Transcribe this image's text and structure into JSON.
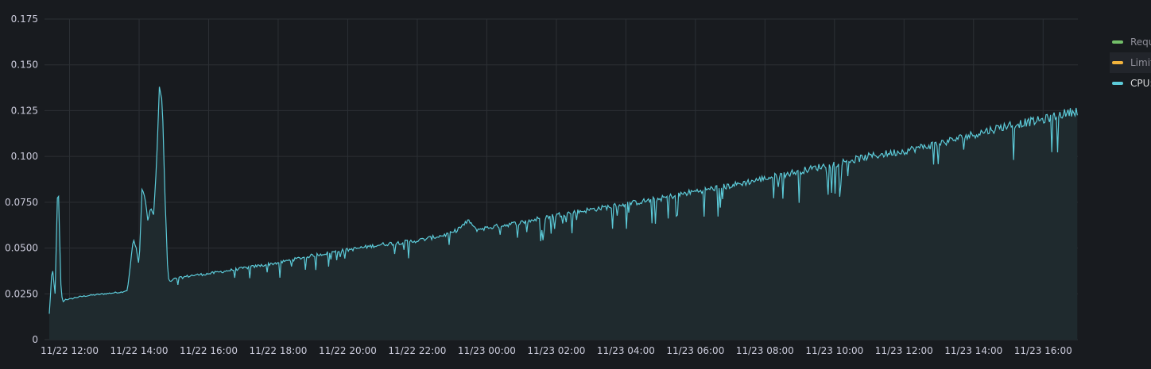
{
  "colors": {
    "background": "#181b1f",
    "grid": "#2c3035",
    "series_cpu": "#5ccad8",
    "series_cpu_fill": "#1f2a2e",
    "series_requests": "#73bf69",
    "series_limits": "#f2b33c",
    "tick_text": "#ccccdc"
  },
  "legend": {
    "placement": "right",
    "items": [
      {
        "label": "Requ",
        "color": "#73bf69"
      },
      {
        "label": "Limit",
        "color": "#f2b33c"
      },
      {
        "label": "CPU:",
        "color": "#5ccad8"
      }
    ]
  },
  "chart_data": {
    "type": "area",
    "title": "",
    "xlabel": "",
    "ylabel": "",
    "ylim": [
      0,
      0.175
    ],
    "xlim": [
      "11/22 11:25",
      "11/23 17:00"
    ],
    "grid": true,
    "yticks": [
      "0",
      "0.0250",
      "0.0500",
      "0.0750",
      "0.100",
      "0.125",
      "0.150",
      "0.175"
    ],
    "ytick_values": [
      0,
      0.025,
      0.05,
      0.075,
      0.1,
      0.125,
      0.15,
      0.175
    ],
    "xticks": [
      "11/22 12:00",
      "11/22 14:00",
      "11/22 16:00",
      "11/22 18:00",
      "11/22 20:00",
      "11/22 22:00",
      "11/23 00:00",
      "11/23 02:00",
      "11/23 04:00",
      "11/23 06:00",
      "11/23 08:00",
      "11/23 10:00",
      "11/23 12:00",
      "11/23 14:00",
      "11/23 16:00"
    ],
    "series": [
      {
        "name": "CPU:",
        "x": [
          "11/22 11:25",
          "11/22 11:30",
          "11/22 11:35",
          "11/22 11:40",
          "11/22 11:45",
          "11/22 11:48",
          "11/22 11:52",
          "11/22 11:56",
          "11/22 12:00",
          "11/22 12:10",
          "11/22 12:30",
          "11/22 13:00",
          "11/22 13:30",
          "11/22 13:40",
          "11/22 13:50",
          "11/22 13:55",
          "11/22 14:00",
          "11/22 14:05",
          "11/22 14:10",
          "11/22 14:15",
          "11/22 14:20",
          "11/22 14:25",
          "11/22 14:30",
          "11/22 14:35",
          "11/22 14:40",
          "11/22 14:45",
          "11/22 14:50",
          "11/22 14:55",
          "11/22 15:00",
          "11/22 15:30",
          "11/22 16:00",
          "11/22 17:00",
          "11/22 18:00",
          "11/22 19:00",
          "11/22 20:00",
          "11/22 21:00",
          "11/22 22:00",
          "11/22 23:00",
          "11/22 23:30",
          "11/22 23:40",
          "11/23 00:00",
          "11/23 01:00",
          "11/23 02:00",
          "11/23 03:00",
          "11/23 04:00",
          "11/23 05:00",
          "11/23 06:00",
          "11/23 07:00",
          "11/23 08:00",
          "11/23 09:00",
          "11/23 10:00",
          "11/23 11:00",
          "11/23 12:00",
          "11/23 13:00",
          "11/23 14:00",
          "11/23 15:00",
          "11/23 16:00",
          "11/23 16:30",
          "11/23 17:00"
        ],
        "values": [
          0.014,
          0.04,
          0.025,
          0.09,
          0.03,
          0.02,
          0.022,
          0.022,
          0.022,
          0.023,
          0.024,
          0.025,
          0.026,
          0.027,
          0.055,
          0.05,
          0.04,
          0.082,
          0.078,
          0.065,
          0.072,
          0.068,
          0.095,
          0.138,
          0.13,
          0.075,
          0.033,
          0.032,
          0.033,
          0.035,
          0.036,
          0.039,
          0.042,
          0.046,
          0.049,
          0.052,
          0.054,
          0.058,
          0.065,
          0.06,
          0.061,
          0.064,
          0.068,
          0.071,
          0.074,
          0.077,
          0.081,
          0.084,
          0.088,
          0.092,
          0.096,
          0.1,
          0.103,
          0.107,
          0.112,
          0.117,
          0.12,
          0.123,
          0.125
        ]
      }
    ]
  }
}
